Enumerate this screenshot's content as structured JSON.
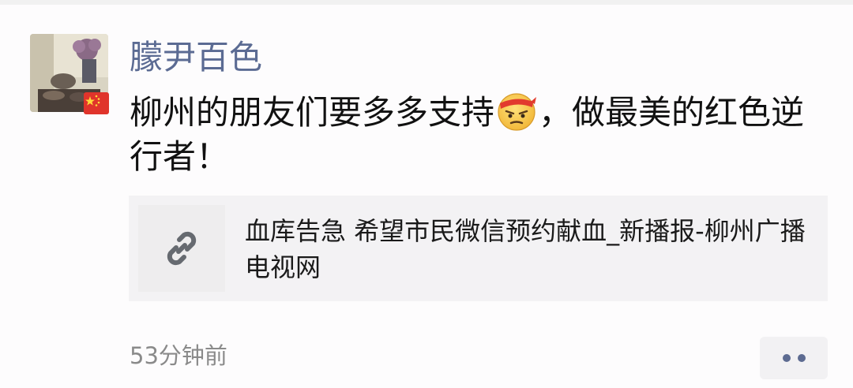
{
  "post": {
    "username": "朦尹百色",
    "avatar": "avatar-photo",
    "flag": "china-flag-badge",
    "text_before_emoji": "柳州的朋友们要多多支持",
    "emoji": "determined-face-emoji",
    "text_after_emoji": "，做最美的红色逆行者！",
    "timestamp": "53分钟前"
  },
  "link_card": {
    "icon": "link-icon",
    "title": "血库告急 希望市民微信预约献血_新播报-柳州广播电视网"
  },
  "more": {
    "icon": "more-dots-icon"
  },
  "colors": {
    "username": "#5b6b93",
    "text": "#111111",
    "card_bg": "#f3f2f4",
    "timestamp": "#8a8a8a",
    "dots": "#5d6b91"
  }
}
